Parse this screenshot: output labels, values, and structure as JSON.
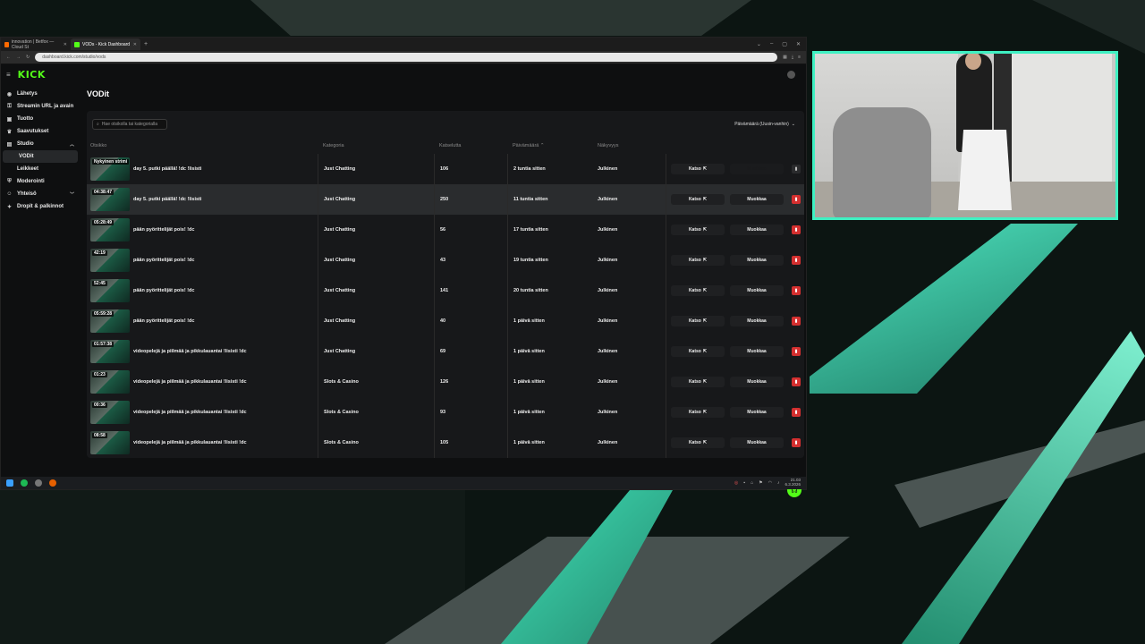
{
  "browser": {
    "tabs": [
      {
        "label": "innovation | Betfox — Cloud St",
        "active": false
      },
      {
        "label": "VODs - Kick Dashboard",
        "active": true
      }
    ],
    "url": "dashboard.kick.com/studio/vods"
  },
  "app": {
    "logo": "KICK",
    "accent": "#53fc18"
  },
  "sidebar": {
    "items": [
      {
        "label": "Lähetys",
        "icon": "broadcast-icon"
      },
      {
        "label": "Streamin URL ja avain",
        "icon": "key-icon"
      },
      {
        "label": "Tuotto",
        "icon": "money-icon"
      },
      {
        "label": "Saavutukset",
        "icon": "trophy-icon"
      },
      {
        "label": "Studio",
        "icon": "studio-icon",
        "expanded": true
      },
      {
        "label": "VODit",
        "sub": true,
        "active": true
      },
      {
        "label": "Leikkeet",
        "sub": true
      },
      {
        "label": "Moderointi",
        "icon": "shield-icon"
      },
      {
        "label": "Yhteisö",
        "icon": "community-icon",
        "expanded": false
      },
      {
        "label": "Dropit & palkinnot",
        "icon": "gift-icon"
      }
    ]
  },
  "page": {
    "title": "VODit",
    "search_placeholder": "Hae otsikolla tai kategorialla",
    "sort_label": "Päivämäärä (Uusin-vanhin)"
  },
  "table": {
    "headers": {
      "title": "Otsikko",
      "category": "Kategoria",
      "views": "Katselutta",
      "date": "Päivämäärä",
      "visibility": "Näkyvyys"
    },
    "watch_label": "Katso",
    "edit_label": "Muokkaa",
    "rows": [
      {
        "badge": "Nykyinen strimi",
        "title": "day 5. putki päällä! !dc !lisisti",
        "category": "Just Chatting",
        "views": "106",
        "date": "2 tuntia sitten",
        "visibility": "Julkinen",
        "editable": false
      },
      {
        "badge": "04:38:47",
        "title": "day 5. putki päällä! !dc !lisisti",
        "category": "Just Chatting",
        "views": "250",
        "date": "11 tuntia sitten",
        "visibility": "Julkinen",
        "editable": true
      },
      {
        "badge": "05:28:49",
        "title": "pään pyörittelijät pois! !dc",
        "category": "Just Chatting",
        "views": "56",
        "date": "17 tuntia sitten",
        "visibility": "Julkinen",
        "editable": true
      },
      {
        "badge": "42:19",
        "title": "pään pyörittelijät pois! !dc",
        "category": "Just Chatting",
        "views": "43",
        "date": "19 tuntia sitten",
        "visibility": "Julkinen",
        "editable": true
      },
      {
        "badge": "52:45",
        "title": "pään pyörittelijät pois! !dc",
        "category": "Just Chatting",
        "views": "141",
        "date": "20 tuntia sitten",
        "visibility": "Julkinen",
        "editable": true
      },
      {
        "badge": "05:59:28",
        "title": "pään pyörittelijät pois! !dc",
        "category": "Just Chatting",
        "views": "40",
        "date": "1 päivä sitten",
        "visibility": "Julkinen",
        "editable": true
      },
      {
        "badge": "01:57:38",
        "title": "videopelejä ja piilmää ja pikkulauantai !lisisti !dc",
        "category": "Just Chatting",
        "views": "69",
        "date": "1 päivä sitten",
        "visibility": "Julkinen",
        "editable": true
      },
      {
        "badge": "01:23",
        "title": "videopelejä ja piilmää ja pikkulauantai !lisisti !dc",
        "category": "Slots & Casino",
        "views": "126",
        "date": "1 päivä sitten",
        "visibility": "Julkinen",
        "editable": true
      },
      {
        "badge": "00:36",
        "title": "videopelejä ja piilmää ja pikkulauantai !lisisti !dc",
        "category": "Slots & Casino",
        "views": "93",
        "date": "1 päivä sitten",
        "visibility": "Julkinen",
        "editable": true
      },
      {
        "badge": "08:58",
        "title": "videopelejä ja piilmää ja pikkulauantai !lisisti !dc",
        "category": "Slots & Casino",
        "views": "105",
        "date": "1 päivä sitten",
        "visibility": "Julkinen",
        "editable": true
      }
    ]
  },
  "taskbar": {
    "time": "21.03",
    "date": "6.3.2026"
  },
  "colors": {
    "cam_border": "#3ff0c2",
    "delete": "#d42f2f"
  }
}
